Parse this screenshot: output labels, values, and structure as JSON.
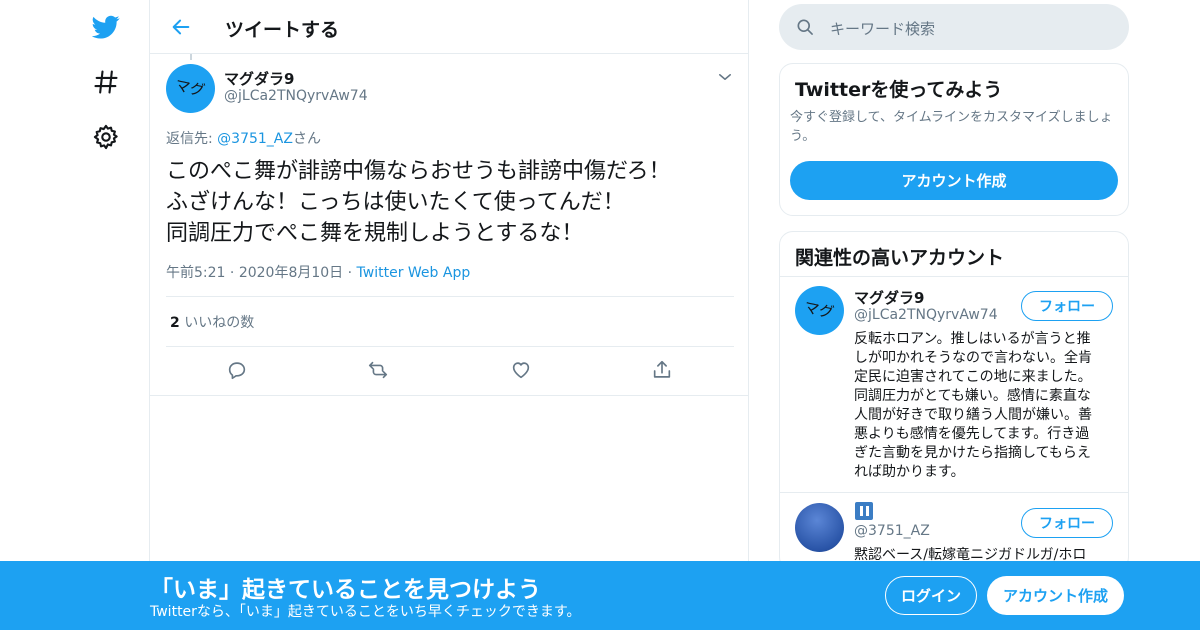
{
  "nav": {
    "icons": [
      "twitter-bird-icon",
      "hashtag-icon",
      "gear-icon"
    ],
    "accent": "#1da1f2"
  },
  "header": {
    "title": "ツイートする"
  },
  "tweet": {
    "author_name": "マグダラ9",
    "author_handle": "@jLCa2TNQyrvAw74",
    "avatar_text": "マグ",
    "reply_prefix": "返信先: ",
    "reply_mention": "@3751_AZ",
    "reply_suffix": "さん",
    "text_lines": [
      "このぺこ舞が誹謗中傷ならおせうも誹謗中傷だろ！",
      "ふざけんな！こっちは使いたくて使ってんだ！",
      "同調圧力でぺこ舞を規制しようとするな！"
    ],
    "time": "午前5:21",
    "date": "2020年8月10日",
    "source": "Twitter Web App",
    "likes_count": "2",
    "likes_label": "いいねの数"
  },
  "search": {
    "placeholder": "キーワード検索"
  },
  "signup_card": {
    "title": "Twitterを使ってみよう",
    "description": "今すぐ登録して、タイムラインをカスタマイズしましょう。",
    "button": "アカウント作成"
  },
  "related": {
    "title": "関連性の高いアカウント",
    "accounts": [
      {
        "name": "マグダラ9",
        "handle": "@jLCa2TNQyrvAw74",
        "follow": "フォロー",
        "bio_lines": [
          "反転ホロアン。推しはいるが言うと推",
          "しが叩かれそうなので言わない。全肯",
          "定民に迫害されてこの地に来ました。",
          "同調圧力がとても嫌い。感情に素直な",
          "人間が好きで取り繕う人間が嫌い。善",
          "悪よりも感情を優先してます。行き過",
          "ぎた言動を見かけたら指摘してもらえ",
          "れば助かります。"
        ]
      },
      {
        "name": "",
        "handle": "@3751_AZ",
        "follow": "フォロー",
        "bio_lines": [
          "黙認ベース/転嫁竜ニジガドルガ/ホロ"
        ]
      }
    ]
  },
  "banner": {
    "title": "「いま」起きていることを見つけよう",
    "subtitle": "Twitterなら、「いま」起きていることをいち早くチェックできます。",
    "login": "ログイン",
    "signup": "アカウント作成"
  }
}
